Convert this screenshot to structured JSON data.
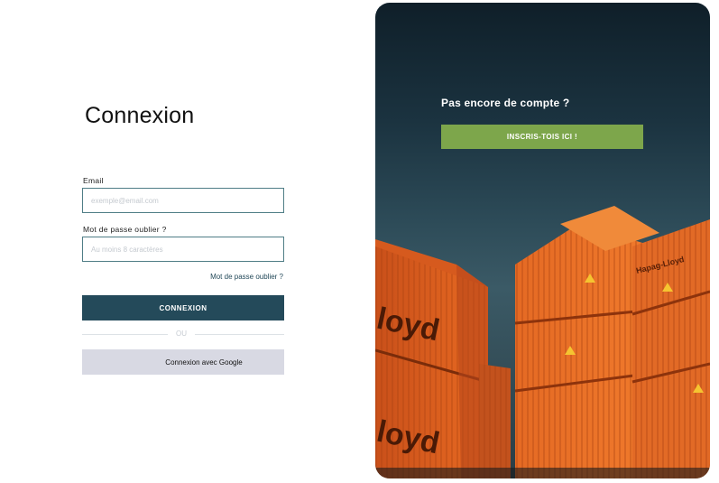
{
  "login": {
    "title": "Connexion",
    "email_label": "Email",
    "email_placeholder": "exemple@email.com",
    "password_label": "Mot de passe oublier ?",
    "password_placeholder": "Au moins 8 caractères",
    "forgot_link": "Mot de passe oublier ?",
    "submit_label": "CONNEXION",
    "divider_text": "OU",
    "google_label": "Connexion avec Google"
  },
  "signup": {
    "prompt": "Pas encore de compte ?",
    "button_label": "INSCRIS-TOIS ICI !"
  },
  "hero_image": {
    "container_text_1": "loyd",
    "container_text_2": "loyd",
    "container_text_3": "Hapag-Lloyd"
  },
  "colors": {
    "primary": "#244a5a",
    "accent_green": "#7da64b",
    "google_bg": "#d8d9e3",
    "container_orange": "#e0601c"
  }
}
